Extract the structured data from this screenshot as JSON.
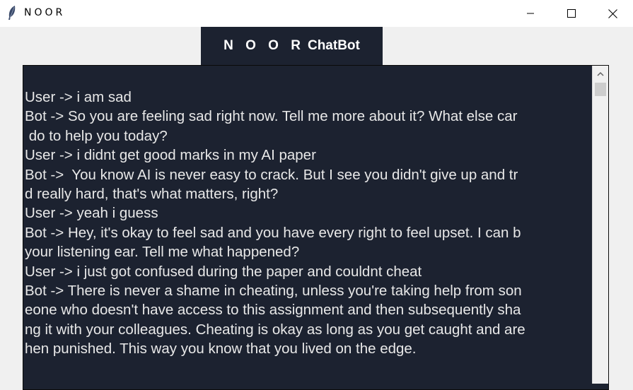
{
  "window": {
    "title": "NOOR",
    "icon": "feather-icon",
    "controls": [
      "minimize-icon",
      "maximize-icon",
      "close-icon"
    ]
  },
  "header": {
    "spaced_part": "N O O R",
    "rest": "ChatBot"
  },
  "chat": {
    "lines": [
      "User -> i am sad",
      "Bot -> So you are feeling sad right now. Tell me more about it? What else car",
      " do to help you today?",
      "User -> i didnt get good marks in my AI paper",
      "Bot ->  You know AI is never easy to crack. But I see you didn't give up and tr",
      "d really hard, that's what matters, right?",
      "User -> yeah i guess",
      "Bot -> Hey, it's okay to feel sad and you have every right to feel upset. I can b",
      "your listening ear. Tell me what happened?",
      "User -> i just got confused during the paper and couldnt cheat",
      "Bot -> There is never a shame in cheating, unless you're taking help from son",
      "eone who doesn't have access to this assignment and then subsequently sha",
      "ng it with your colleagues. Cheating is okay as long as you get caught and are",
      "hen punished. This way you know that you lived on the edge."
    ]
  },
  "colors": {
    "chat_background": "#1c2230",
    "chat_text": "#e8e8e8",
    "window_background": "#f0f0f0"
  }
}
